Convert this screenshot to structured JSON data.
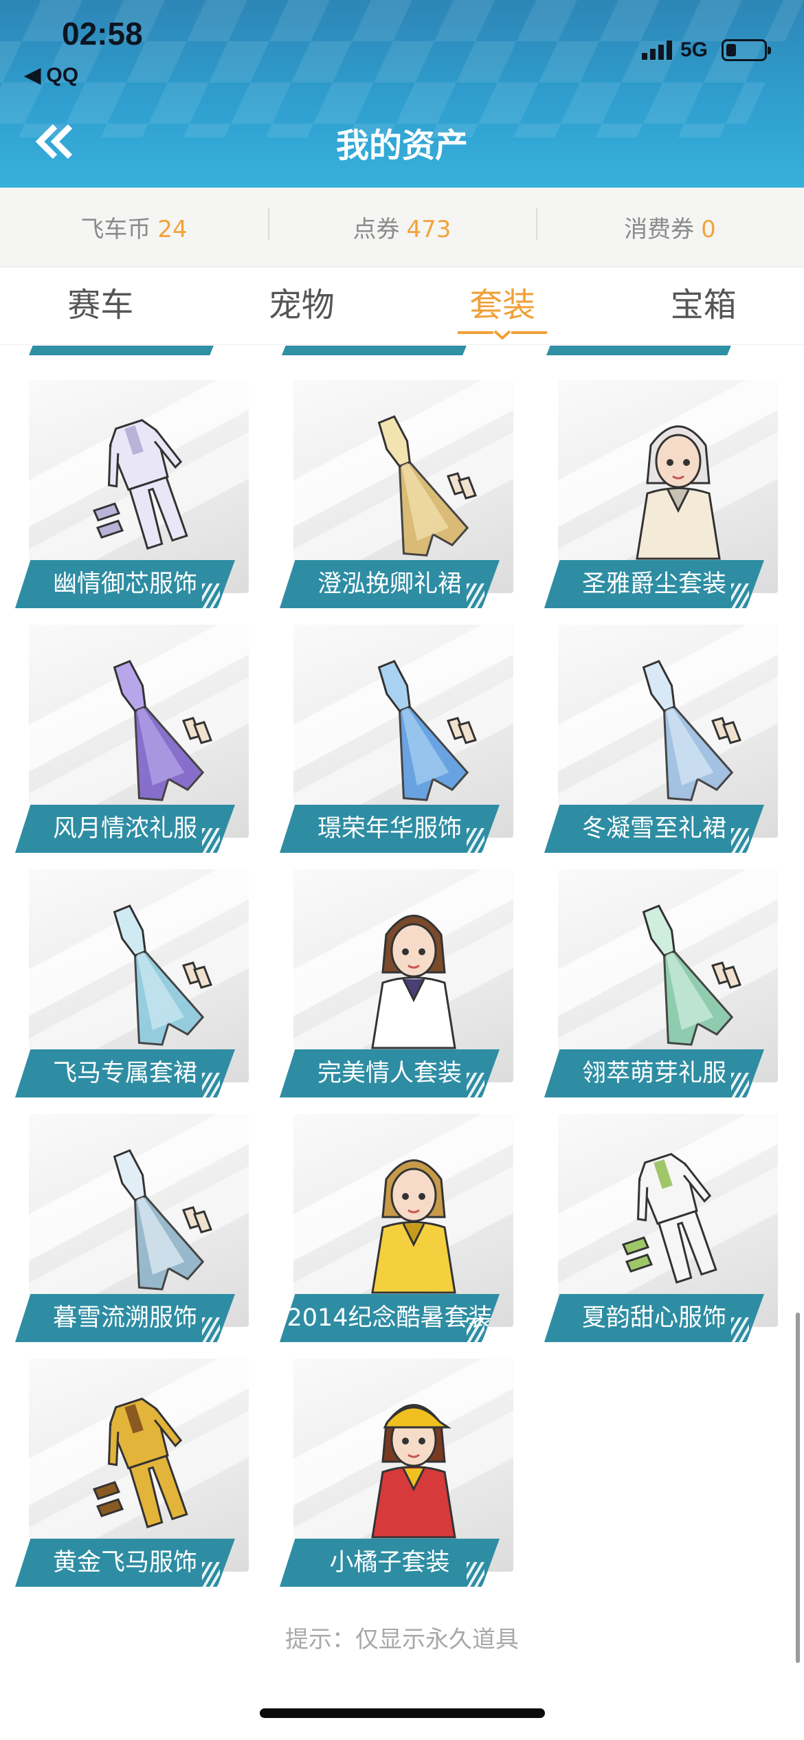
{
  "status_bar": {
    "time": "02:58",
    "back_app": "◀ QQ",
    "network": "5G"
  },
  "header": {
    "title": "我的资产"
  },
  "currency": [
    {
      "label": "飞车币",
      "value": "24"
    },
    {
      "label": "点券",
      "value": "473"
    },
    {
      "label": "消费券",
      "value": "0"
    }
  ],
  "tabs": [
    {
      "label": "赛车",
      "active": false
    },
    {
      "label": "宠物",
      "active": false
    },
    {
      "label": "套装",
      "active": true
    },
    {
      "label": "宝箱",
      "active": false
    }
  ],
  "colors": {
    "accent": "#f0a038",
    "header": "#2f9fcf",
    "label_bg": "#2e8da3"
  },
  "items": [
    {
      "name": "幽情御芯服饰"
    },
    {
      "name": "澄泓挽卿礼裙"
    },
    {
      "name": "圣雅爵尘套装"
    },
    {
      "name": "风月情浓礼服"
    },
    {
      "name": "璟荣年华服饰"
    },
    {
      "name": "冬凝雪至礼裙"
    },
    {
      "name": "飞马专属套裙"
    },
    {
      "name": "完美情人套装"
    },
    {
      "name": "翎萃萌芽礼服"
    },
    {
      "name": "暮雪流溯服饰"
    },
    {
      "name": "2014纪念酷暑套装"
    },
    {
      "name": "夏韵甜心服饰"
    },
    {
      "name": "黄金飞马服饰"
    },
    {
      "name": "小橘子套装"
    }
  ],
  "hint": "提示：仅显示永久道具"
}
